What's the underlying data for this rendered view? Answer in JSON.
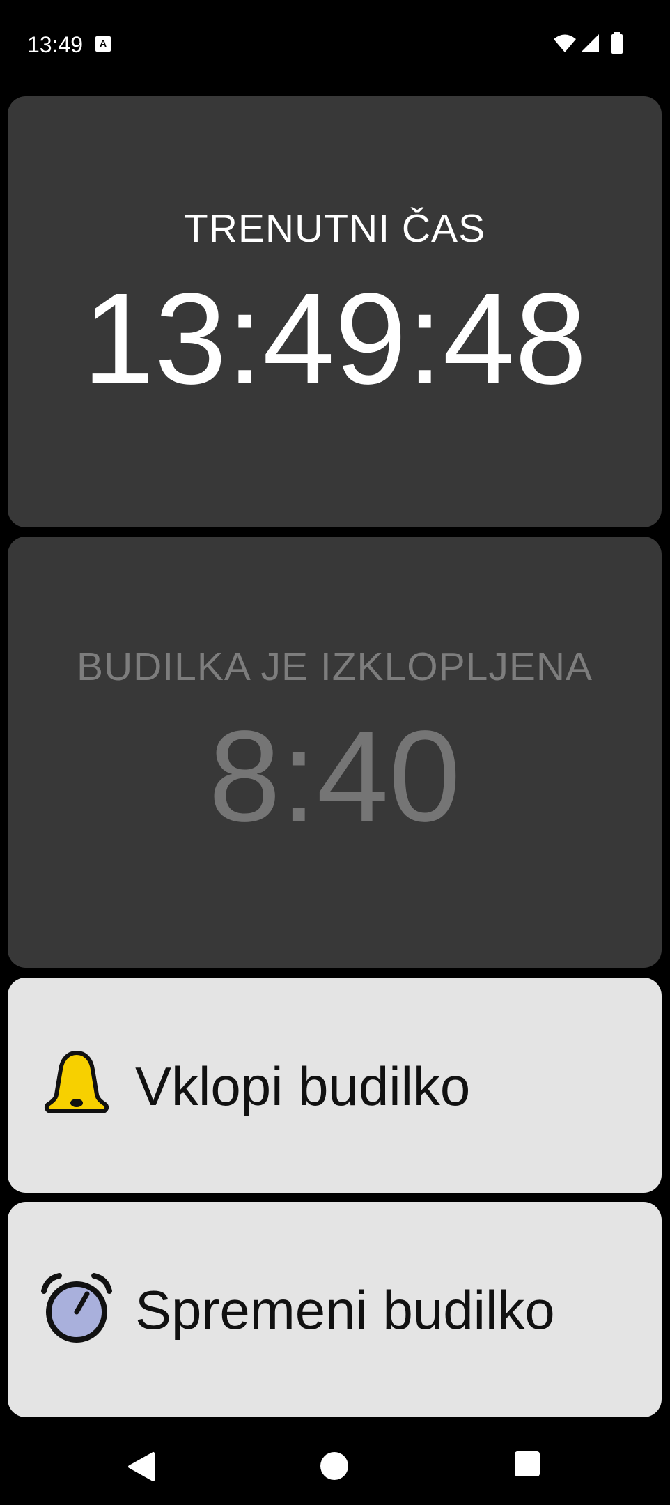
{
  "status_bar": {
    "time": "13:49",
    "icons": [
      "notification-a-icon",
      "wifi-icon",
      "signal-icon",
      "battery-icon"
    ]
  },
  "clock": {
    "label": "TRENUTNI ČAS",
    "time": "13:49:48"
  },
  "alarm": {
    "label": "BUDILKA JE IZKLOPLJENA",
    "time": "8:40"
  },
  "actions": {
    "enable_label": "Vklopi budilko",
    "enable_icon": "bell-icon",
    "change_label": "Spremeni budilko",
    "change_icon": "alarm-clock-icon"
  },
  "colors": {
    "background": "#000000",
    "panel_dark": "#383838",
    "panel_light": "#e4e4e4",
    "bell": "#f7d000",
    "alarm_clock_face": "#a9b0dc",
    "disabled_text": "#7d7d7d"
  },
  "nav_bar": {
    "buttons": [
      "back-icon",
      "home-icon",
      "recents-icon"
    ]
  }
}
